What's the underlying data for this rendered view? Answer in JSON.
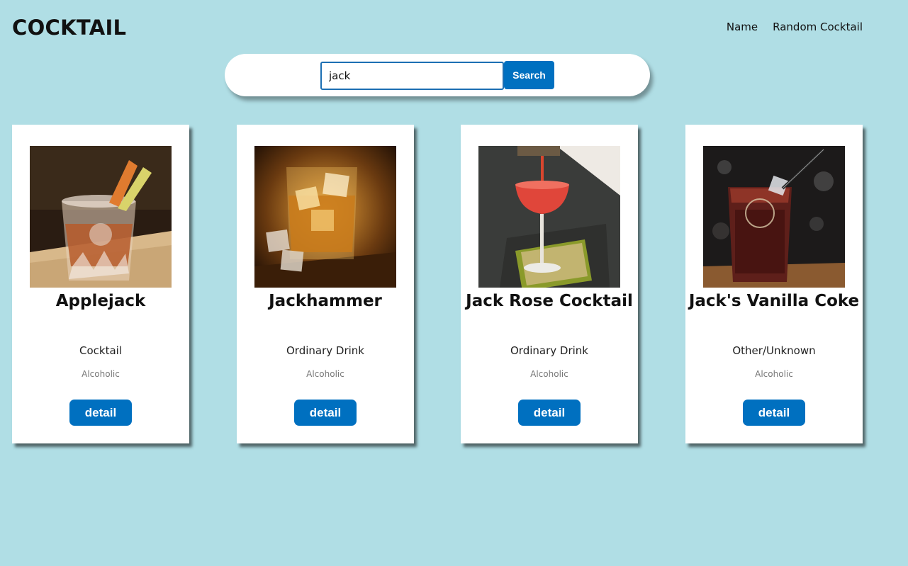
{
  "header": {
    "logo": "COCKTAIL",
    "nav": [
      {
        "label": "Name"
      },
      {
        "label": "Random Cocktail"
      }
    ]
  },
  "search": {
    "value": "jack",
    "button_label": "Search"
  },
  "cards": [
    {
      "name": "Applejack",
      "category": "Cocktail",
      "alcoholic": "Alcoholic",
      "button_label": "detail",
      "image": "applejack-drink-photo"
    },
    {
      "name": "Jackhammer",
      "category": "Ordinary Drink",
      "alcoholic": "Alcoholic",
      "button_label": "detail",
      "image": "whiskey-on-ice-photo"
    },
    {
      "name": "Jack Rose Cocktail",
      "category": "Ordinary Drink",
      "alcoholic": "Alcoholic",
      "button_label": "detail",
      "image": "red-coupe-cocktail-photo"
    },
    {
      "name": "Jack's Vanilla Coke",
      "category": "Other/Unknown",
      "alcoholic": "Alcoholic",
      "button_label": "detail",
      "image": "cola-highball-photo"
    }
  ],
  "colors": {
    "background": "#b0dee5",
    "accent": "#0070c0"
  }
}
